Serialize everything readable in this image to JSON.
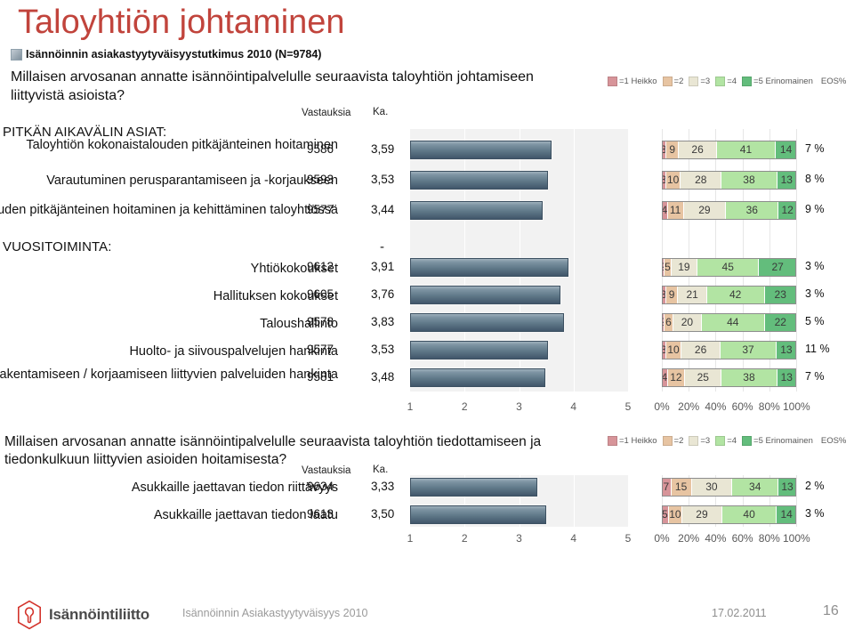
{
  "slide": {
    "title": "Taloyhtiön johtaminen",
    "subhead": "Isännöinnin asiakastyytyväisyystutkimus 2010 (N=9784)",
    "question1": "Millaisen arvosanan annatte isännöintipalvelulle seuraavista taloyhtiön johtamiseen liittyvistä asioista?",
    "question2": "Millaisen arvosanan annatte isännöintipalvelulle seuraavista taloyhtiön tiedottamiseen ja tiedonkulkuun liittyvien asioiden hoitamisesta?"
  },
  "columns": {
    "responses": "Vastauksia",
    "mean": "Ka."
  },
  "sections": {
    "long_term": "PITKÄN AIKAVÄLIN ASIAT:",
    "annual": "VUOSITOIMINTA:",
    "annual_mean_placeholder": "-"
  },
  "legend": {
    "items": [
      {
        "label": "=1 Heikko",
        "color": "#d79499"
      },
      {
        "label": "=2",
        "color": "#e7c4a2"
      },
      {
        "label": "=3",
        "color": "#e9e6d4"
      },
      {
        "label": "=4",
        "color": "#b2e4a3"
      },
      {
        "label": "=5 Erinomainen",
        "color": "#63bd7c"
      }
    ],
    "eos": "EOS%"
  },
  "axes": {
    "mean_ticks": [
      "1",
      "2",
      "3",
      "4",
      "5"
    ],
    "mean_range": [
      1,
      5
    ],
    "percent_ticks": [
      "0%",
      "20%",
      "40%",
      "60%",
      "80%",
      "100%"
    ],
    "percent_range": [
      0,
      100
    ]
  },
  "chart_data": [
    {
      "type": "bar",
      "title": "Millaisen arvosanan annatte isännöintipalvelulle seuraavista taloyhtiön johtamiseen liittyvistä asioista?",
      "xlabel": "",
      "ylabel": "",
      "xlim": [
        1,
        5
      ],
      "grid": true,
      "legend": [
        "=1 Heikko",
        "=2",
        "=3",
        "=4",
        "=5 Erinomainen"
      ],
      "legend_position": "top-right",
      "columns": [
        "Vastauksia",
        "Ka.",
        "1",
        "2",
        "3",
        "4",
        "5",
        "EOS%"
      ],
      "rows": [
        {
          "label": "Taloyhtiön kokonaistalouden pitkäjänteinen hoitaminen",
          "responses": "9586",
          "mean": "3,59",
          "mean_value": 3.59,
          "dist": [
            3,
            9,
            26,
            41,
            14
          ],
          "eos": "7 %",
          "section": "PITKÄN AIKAVÄLIN ASIAT:"
        },
        {
          "label": "Varautuminen perusparantamiseen ja -korjaukseen",
          "responses": "9593",
          "mean": "3,53",
          "mean_value": 3.53,
          "dist": [
            3,
            10,
            28,
            38,
            13
          ],
          "eos": "8 %",
          "section": "PITKÄN AIKAVÄLIN ASIAT:"
        },
        {
          "label": "Toimivuuden pitkäjänteinen hoitaminen ja kehittäminen taloyhtiössä",
          "responses": "9577",
          "mean": "3,44",
          "mean_value": 3.44,
          "dist": [
            4,
            11,
            29,
            36,
            12
          ],
          "eos": "9 %",
          "section": "PITKÄN AIKAVÄLIN ASIAT:"
        },
        {
          "label": "Yhtiökokoukset",
          "responses": "9612",
          "mean": "3,91",
          "mean_value": 3.91,
          "dist": [
            2,
            5,
            19,
            45,
            27
          ],
          "eos": "3 %",
          "section": "VUOSITOIMINTA:"
        },
        {
          "label": "Hallituksen kokoukset",
          "responses": "9605",
          "mean": "3,76",
          "mean_value": 3.76,
          "dist": [
            3,
            9,
            21,
            42,
            23
          ],
          "eos": "3 %",
          "section": "VUOSITOIMINTA:"
        },
        {
          "label": "Taloushallinto",
          "responses": "9578",
          "mean": "3,83",
          "mean_value": 3.83,
          "dist": [
            2,
            6,
            20,
            44,
            22
          ],
          "eos": "5 %",
          "section": "VUOSITOIMINTA:"
        },
        {
          "label": "Huolto- ja siivouspalvelujen hankinta",
          "responses": "9577",
          "mean": "3,53",
          "mean_value": 3.53,
          "dist": [
            3,
            10,
            26,
            37,
            13
          ],
          "eos": "11 %",
          "section": "VUOSITOIMINTA:"
        },
        {
          "label": "Rakentamiseen / korjaamiseen liittyvien palveluiden hankinta",
          "responses": "9581",
          "mean": "3,48",
          "mean_value": 3.48,
          "dist": [
            4,
            12,
            25,
            38,
            13
          ],
          "eos": "7 %",
          "section": "VUOSITOIMINTA:"
        }
      ]
    },
    {
      "type": "bar",
      "title": "Millaisen arvosanan annatte isännöintipalvelulle seuraavista taloyhtiön tiedottamiseen ja tiedonkulkuun liittyvien asioiden hoitamisesta?",
      "xlabel": "",
      "ylabel": "",
      "xlim": [
        1,
        5
      ],
      "grid": true,
      "legend": [
        "=1 Heikko",
        "=2",
        "=3",
        "=4",
        "=5 Erinomainen"
      ],
      "legend_position": "top-right",
      "columns": [
        "Vastauksia",
        "Ka.",
        "1",
        "2",
        "3",
        "4",
        "5",
        "EOS%"
      ],
      "rows": [
        {
          "label": "Asukkaille jaettavan tiedon riittävyys",
          "responses": "9634",
          "mean": "3,33",
          "mean_value": 3.33,
          "dist": [
            7,
            15,
            30,
            34,
            13
          ],
          "eos": "2 %"
        },
        {
          "label": "Asukkaille jaettavan tiedon laatu",
          "responses": "9613",
          "mean": "3,50",
          "mean_value": 3.5,
          "dist": [
            5,
            10,
            29,
            40,
            14
          ],
          "eos": "3 %"
        }
      ]
    }
  ],
  "footer": {
    "logo_text": "Isännöintiliitto",
    "note": "Isännöinnin Asiakastyytyväisyys 2010",
    "date": "17.02.2011",
    "page": "16"
  }
}
